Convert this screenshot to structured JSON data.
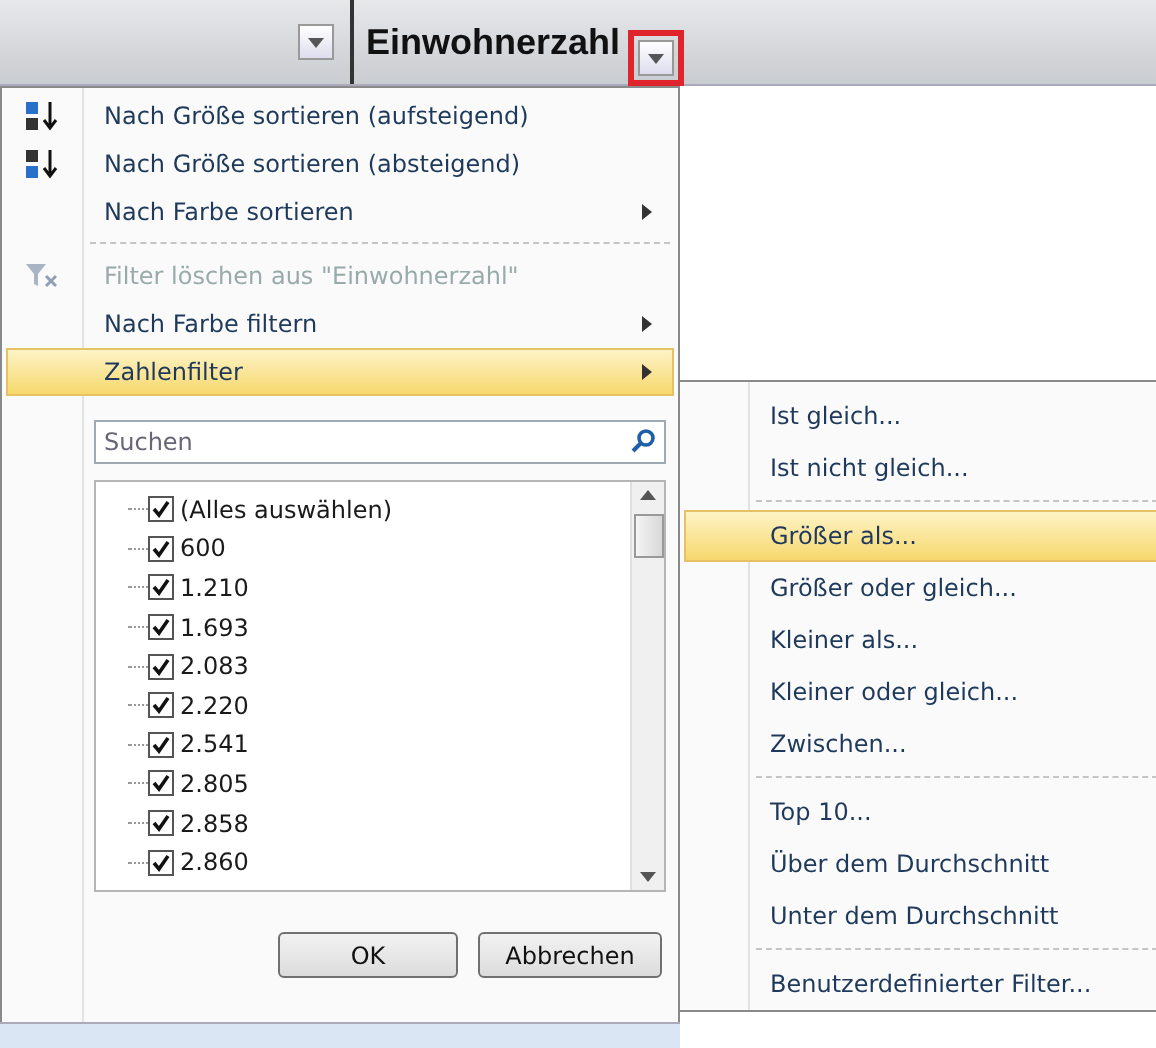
{
  "header": {
    "column_title": "Einwohnerzahl"
  },
  "menu": [
    {
      "kind": "item",
      "label": "Nach Größe sortieren (aufsteigend)",
      "disabled": false,
      "submenu": false,
      "selected": false
    },
    {
      "kind": "item",
      "label": "Nach Größe sortieren (absteigend)",
      "disabled": false,
      "submenu": false,
      "selected": false
    },
    {
      "kind": "item",
      "label": "Nach Farbe sortieren",
      "disabled": false,
      "submenu": true,
      "selected": false
    },
    {
      "kind": "separator"
    },
    {
      "kind": "item",
      "label": "Filter löschen aus \"Einwohnerzahl\"",
      "disabled": true,
      "submenu": false,
      "selected": false
    },
    {
      "kind": "item",
      "label": "Nach Farbe filtern",
      "disabled": false,
      "submenu": true,
      "selected": false
    },
    {
      "kind": "item",
      "label": "Zahlenfilter",
      "disabled": false,
      "submenu": true,
      "selected": true
    }
  ],
  "search": {
    "placeholder": "Suchen"
  },
  "values": [
    {
      "label": "(Alles auswählen)",
      "checked": true
    },
    {
      "label": "600",
      "checked": true
    },
    {
      "label": "1.210",
      "checked": true
    },
    {
      "label": "1.693",
      "checked": true
    },
    {
      "label": "2.083",
      "checked": true
    },
    {
      "label": "2.220",
      "checked": true
    },
    {
      "label": "2.541",
      "checked": true
    },
    {
      "label": "2.805",
      "checked": true
    },
    {
      "label": "2.858",
      "checked": true
    },
    {
      "label": "2.860",
      "checked": true
    }
  ],
  "buttons": [
    "OK",
    "Abbrechen"
  ],
  "submenu": [
    {
      "kind": "item",
      "label": "Ist gleich...",
      "selected": false
    },
    {
      "kind": "item",
      "label": "Ist nicht gleich...",
      "selected": false
    },
    {
      "kind": "separator"
    },
    {
      "kind": "item",
      "label": "Größer als...",
      "selected": true
    },
    {
      "kind": "item",
      "label": "Größer oder gleich...",
      "selected": false
    },
    {
      "kind": "item",
      "label": "Kleiner als...",
      "selected": false
    },
    {
      "kind": "item",
      "label": "Kleiner oder gleich...",
      "selected": false
    },
    {
      "kind": "item",
      "label": "Zwischen...",
      "selected": false
    },
    {
      "kind": "separator"
    },
    {
      "kind": "item",
      "label": "Top 10...",
      "selected": false
    },
    {
      "kind": "item",
      "label": "Über dem Durchschnitt",
      "selected": false
    },
    {
      "kind": "item",
      "label": "Unter dem Durchschnitt",
      "selected": false
    },
    {
      "kind": "separator"
    },
    {
      "kind": "item",
      "label": "Benutzerdefinierter Filter...",
      "selected": false
    }
  ]
}
